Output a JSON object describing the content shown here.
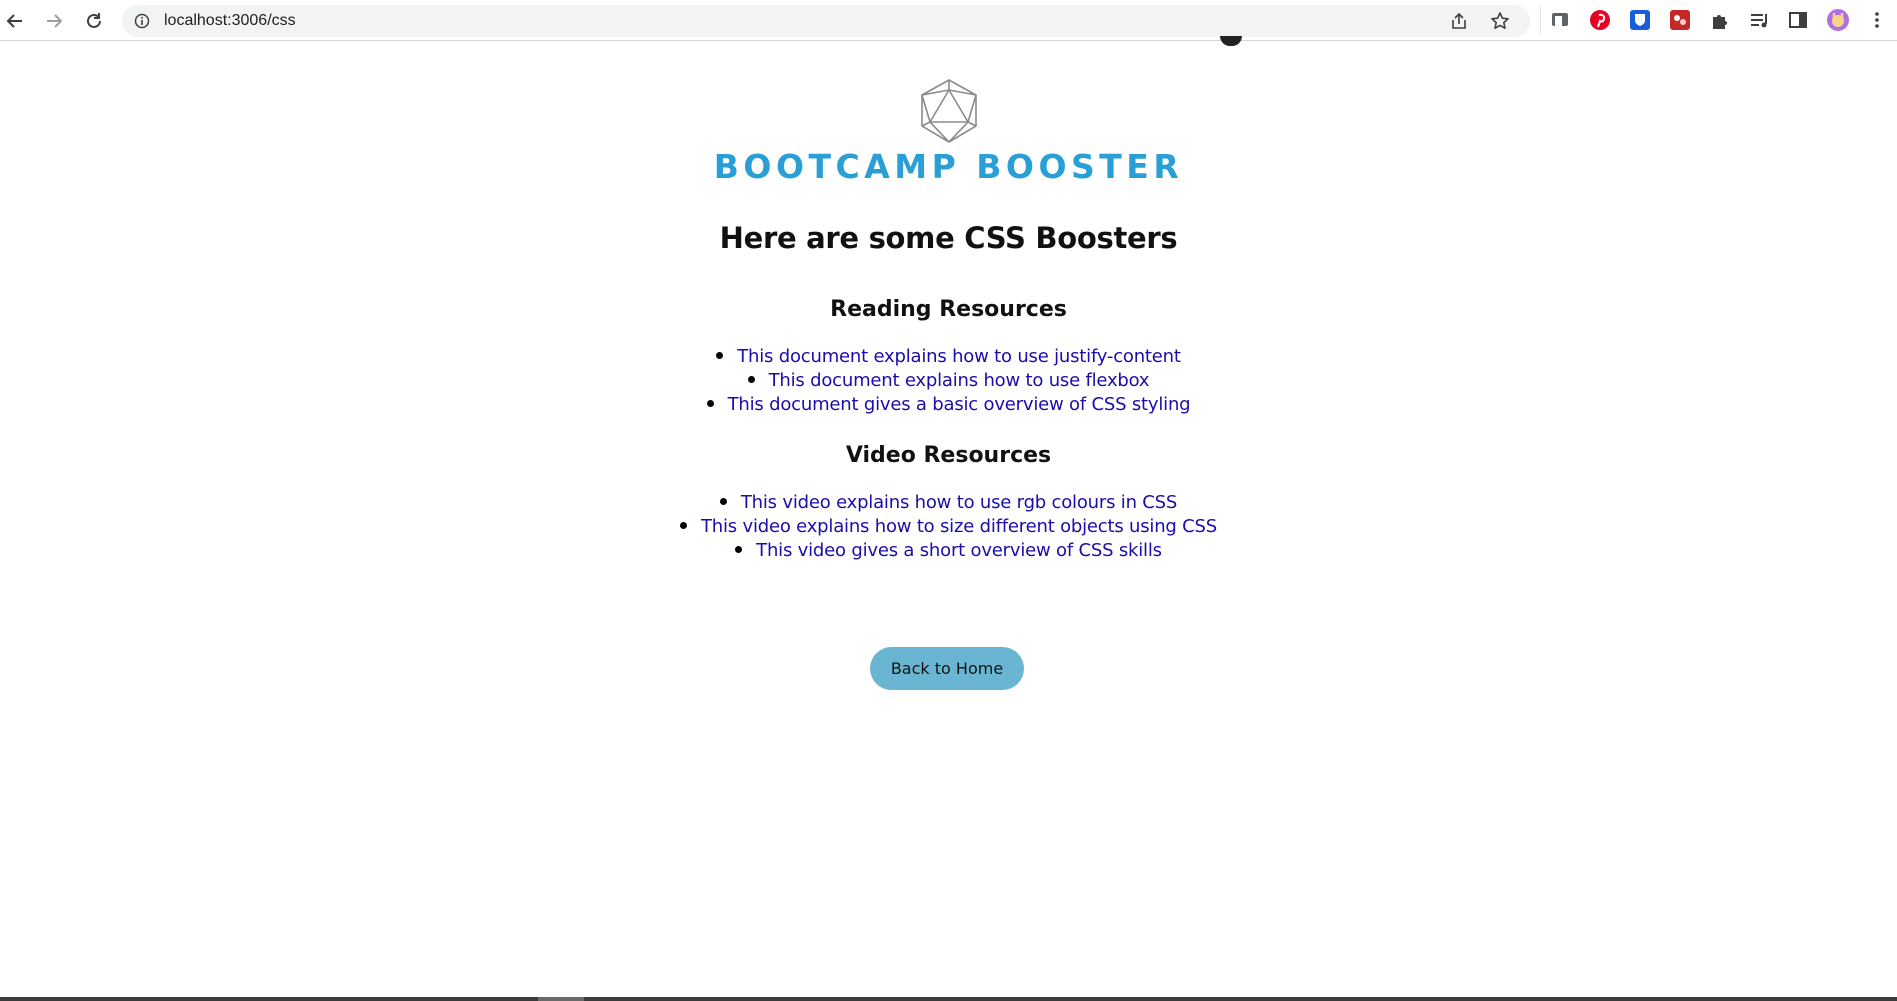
{
  "browser": {
    "url": "localhost:3006/css",
    "icons": [
      "back-arrow-icon",
      "forward-arrow-icon",
      "reload-icon",
      "site-info-icon",
      "share-icon",
      "bookmark-star-icon",
      "screencast-extension-icon",
      "pinterest-icon",
      "bitwarden-icon",
      "red-extension-icon",
      "extensions-puzzle-icon",
      "reading-list-icon",
      "side-panel-icon",
      "profile-avatar",
      "more-menu-icon"
    ]
  },
  "logo": {
    "wordmark": "BOOTCAMP BOOSTER"
  },
  "page": {
    "heading": "Here are some CSS Boosters",
    "reading": {
      "title": "Reading Resources",
      "items": [
        "This document explains how to use justify-content",
        "This document explains how to use flexbox",
        "This document gives a basic overview of CSS styling"
      ]
    },
    "video": {
      "title": "Video Resources",
      "items": [
        "This video explains how to use rgb colours in CSS",
        "This video explains how to size different objects using CSS",
        "This video gives a short overview of CSS skills"
      ]
    },
    "back_button": "Back to Home"
  },
  "colors": {
    "brand": "#2a9fd6",
    "link": "#1a0dab",
    "button": "#6ab6d2"
  }
}
